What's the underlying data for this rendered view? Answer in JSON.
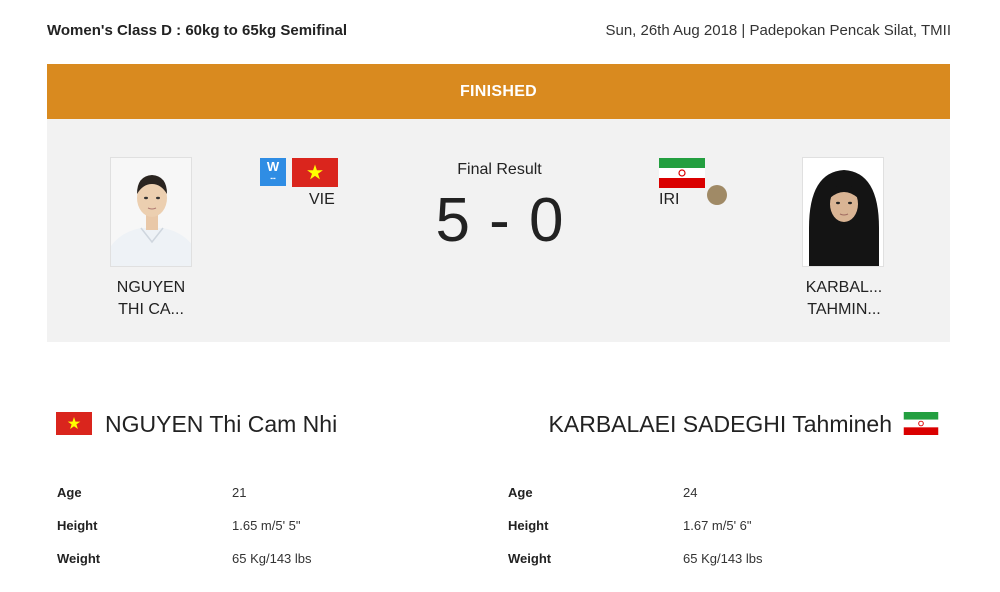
{
  "header": {
    "event_title": "Women's Class D : 60kg to 65kg Semifinal",
    "event_meta": "Sun, 26th Aug 2018 | Padepokan Pencak Silat, TMII"
  },
  "status": {
    "label": "FINISHED",
    "color": "#d98a1f"
  },
  "match": {
    "result_label": "Final Result",
    "score": "5 - 0",
    "left": {
      "badge_letter": "W",
      "country_code": "VIE",
      "short_name_line1": "NGUYEN",
      "short_name_line2": "THI CA...",
      "flag_icon": "vietnam-flag-icon"
    },
    "right": {
      "country_code": "IRI",
      "short_name_line1": "KARBAL...",
      "short_name_line2": "TAHMIN...",
      "flag_icon": "iran-flag-icon",
      "marker_icon": "ball-icon"
    }
  },
  "athletes": {
    "left": {
      "full_name": "NGUYEN Thi Cam Nhi",
      "rows": [
        {
          "key": "Age",
          "value": "21"
        },
        {
          "key": "Height",
          "value": "1.65 m/5' 5\""
        },
        {
          "key": "Weight",
          "value": "65 Kg/143 lbs"
        }
      ]
    },
    "right": {
      "full_name": "KARBALAEI SADEGHI Tahmineh",
      "rows": [
        {
          "key": "Age",
          "value": "24"
        },
        {
          "key": "Height",
          "value": "1.67 m/5' 6\""
        },
        {
          "key": "Weight",
          "value": "65 Kg/143 lbs"
        }
      ]
    }
  }
}
